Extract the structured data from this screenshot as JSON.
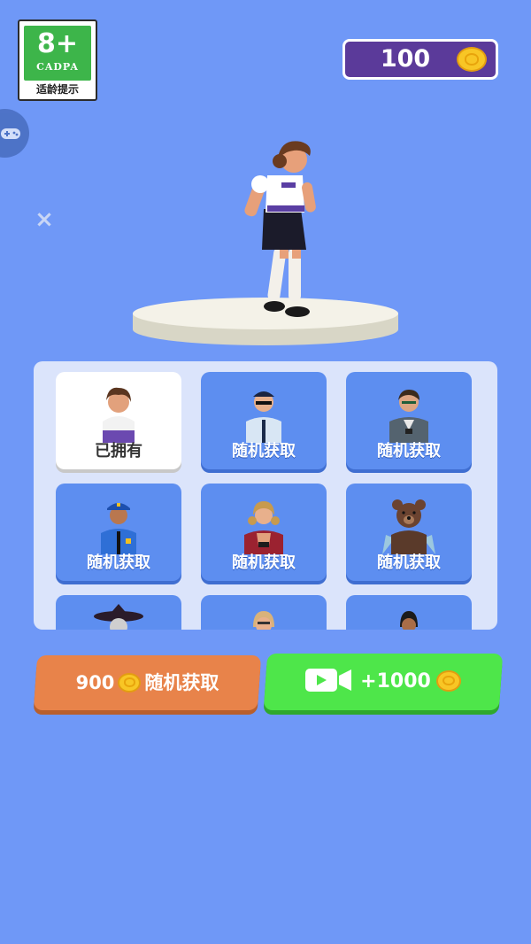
{
  "age_badge": {
    "rating": "8+",
    "org": "CADPA",
    "caption": "适龄提示"
  },
  "currency": {
    "amount": "100",
    "icon": "coin-icon"
  },
  "skins": [
    {
      "label": "已拥有",
      "owned": true,
      "character": "schoolgirl"
    },
    {
      "label": "随机获取",
      "owned": false,
      "character": "security-guard"
    },
    {
      "label": "随机获取",
      "owned": false,
      "character": "man-with-badge"
    },
    {
      "label": "随机获取",
      "owned": false,
      "character": "police-officer"
    },
    {
      "label": "随机获取",
      "owned": false,
      "character": "girl-plaid-shirt"
    },
    {
      "label": "随机获取",
      "owned": false,
      "character": "teddy-bear"
    },
    {
      "label": "",
      "owned": false,
      "character": "witch"
    },
    {
      "label": "",
      "owned": false,
      "character": "blonde-woman"
    },
    {
      "label": "",
      "owned": false,
      "character": "dark-hair-person"
    }
  ],
  "buy_button": {
    "price": "900",
    "label": "随机获取"
  },
  "video_button": {
    "reward": "+1000",
    "icon": "video-camera-icon"
  },
  "colors": {
    "background": "#6f98f7",
    "buy": "#e8834a",
    "video": "#4ee64a",
    "coin_box": "#5b3a9a"
  }
}
